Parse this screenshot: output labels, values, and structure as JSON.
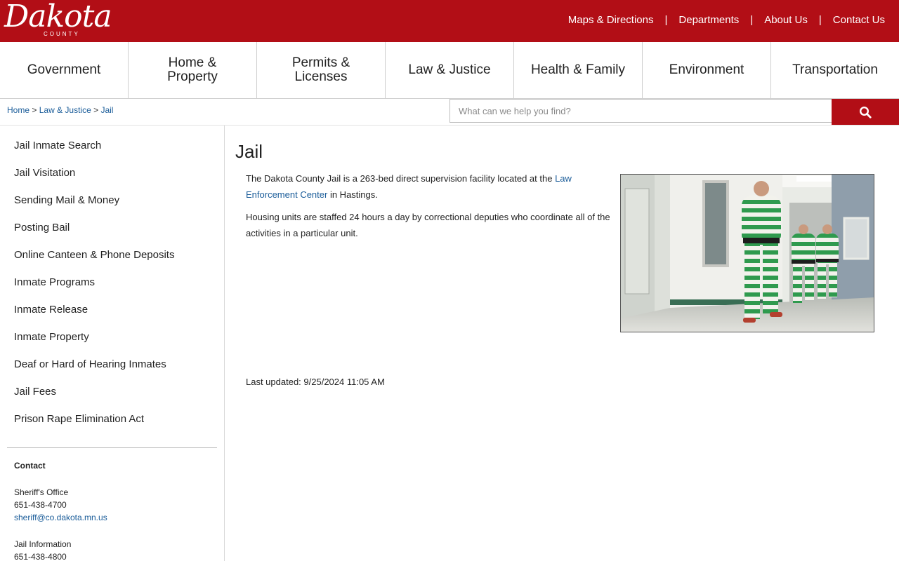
{
  "brand": {
    "logo_text": "Dakota",
    "logo_sub": "COUNTY"
  },
  "toplinks": [
    {
      "label": "Maps & Directions"
    },
    {
      "label": "Departments"
    },
    {
      "label": "About Us"
    },
    {
      "label": "Contact Us"
    }
  ],
  "separator": "|",
  "nav": [
    {
      "label": "Government"
    },
    {
      "label": "Home & Property"
    },
    {
      "label": "Permits & Licenses"
    },
    {
      "label": "Law & Justice"
    },
    {
      "label": "Health & Family"
    },
    {
      "label": "Environment"
    },
    {
      "label": "Transportation"
    }
  ],
  "breadcrumb": {
    "home": "Home",
    "section": "Law & Justice",
    "current": "Jail",
    "sep": ">"
  },
  "search": {
    "placeholder": "What can we help you find?",
    "icon": "search-icon"
  },
  "sidebar": {
    "items": [
      {
        "label": "Jail Inmate Search"
      },
      {
        "label": "Jail Visitation"
      },
      {
        "label": "Sending Mail & Money"
      },
      {
        "label": "Posting Bail"
      },
      {
        "label": "Online Canteen & Phone Deposits"
      },
      {
        "label": "Inmate Programs"
      },
      {
        "label": "Inmate Release"
      },
      {
        "label": "Inmate Property"
      },
      {
        "label": "Deaf or Hard of Hearing Inmates"
      },
      {
        "label": "Jail Fees"
      },
      {
        "label": "Prison Rape Elimination Act"
      }
    ],
    "contact": {
      "heading": "Contact",
      "groups": [
        {
          "name": "Sheriff's Office",
          "phone": "651-438-4700",
          "email": "sheriff@co.dakota.mn.us"
        },
        {
          "name": "Jail Information",
          "phone": "651-438-4800"
        }
      ]
    }
  },
  "main": {
    "title": "Jail",
    "p1_before": "The Dakota County Jail is a 263-bed direct supervision facility located at the ",
    "p1_link": "Law Enforcement Center",
    "p1_after": " in Hastings.",
    "p2": "Housing units are staffed 24 hours a day by correctional deputies who coordinate all of the activities in a particular unit.",
    "updated": "Last updated: 9/25/2024 11:05 AM"
  },
  "colors": {
    "brand_red": "#b20e16",
    "link_blue": "#1a5c99"
  }
}
